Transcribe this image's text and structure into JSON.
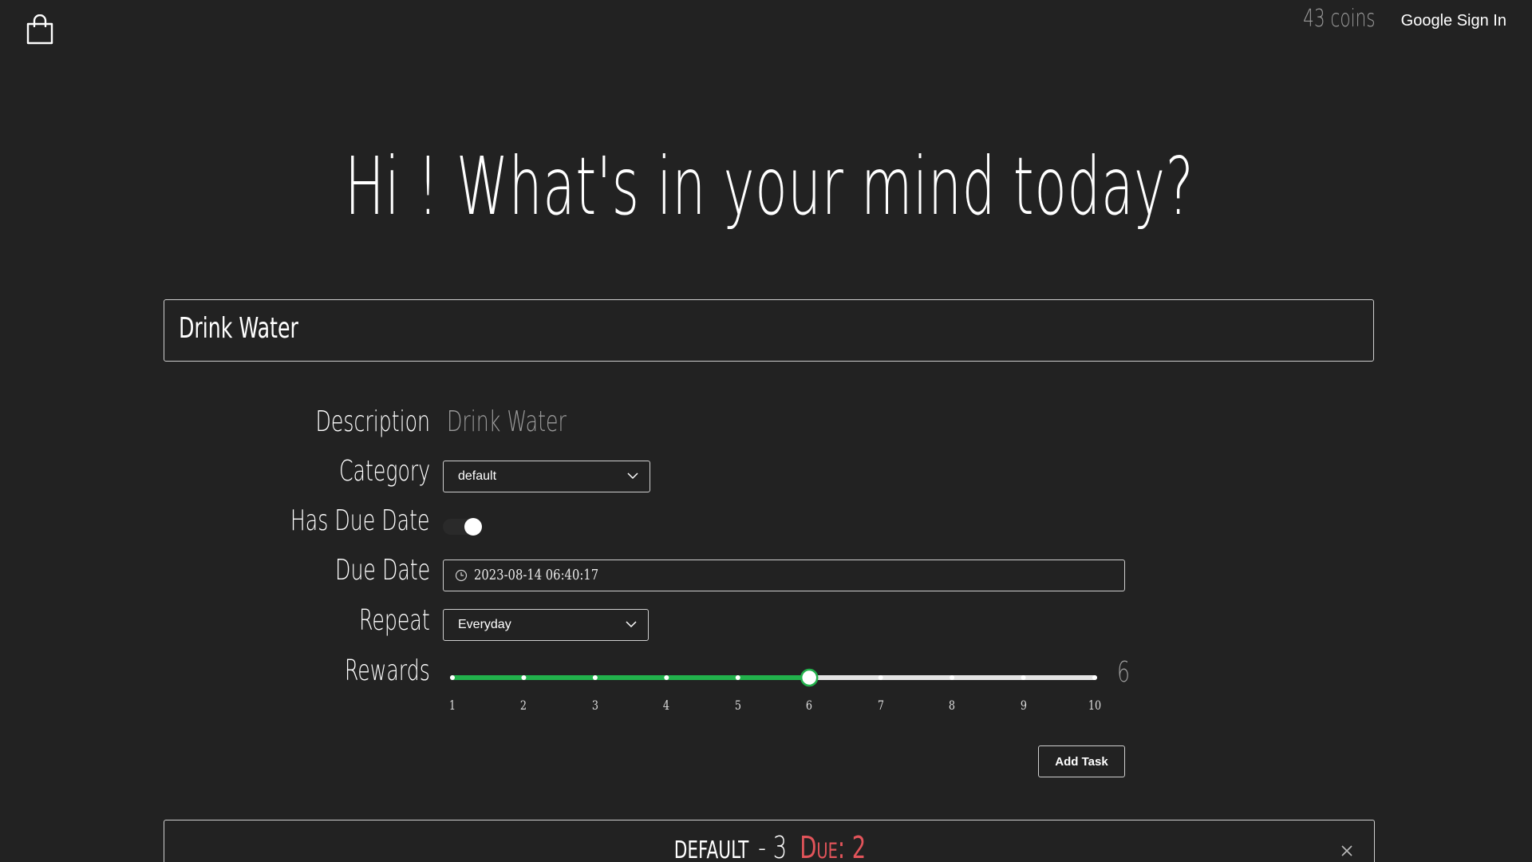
{
  "header": {
    "bag_icon": "shopping-bag-icon",
    "coins_text": "43 coins",
    "signin_label": "Google Sign In"
  },
  "hero": {
    "title": "Hi ! What's in your mind today?"
  },
  "task_input": {
    "value": "Drink Water"
  },
  "form": {
    "description": {
      "label": "Description",
      "value": "Drink Water"
    },
    "category": {
      "label": "Category",
      "selected": "default"
    },
    "has_due_date": {
      "label": "Has Due Date",
      "on": true
    },
    "due_date": {
      "label": "Due Date",
      "value": "2023-08-14 06:40:17",
      "icon": "clock-icon"
    },
    "repeat": {
      "label": "Repeat",
      "selected": "Everyday"
    },
    "rewards": {
      "label": "Rewards",
      "min": 1,
      "max": 10,
      "value": 6,
      "value_text": "6",
      "ticks": [
        "1",
        "2",
        "3",
        "4",
        "5",
        "6",
        "7",
        "8",
        "9",
        "10"
      ]
    },
    "add_label": "Add Task"
  },
  "category_panel": {
    "name": "DEFAULT",
    "count": "- 3",
    "due": "Due: 2",
    "close_icon": "close-icon"
  },
  "colors": {
    "background": "#222222",
    "accent_green": "#22b24c",
    "due_red": "#e2545a",
    "muted_text": "#9a9a9a",
    "border": "#cfcfcf"
  }
}
